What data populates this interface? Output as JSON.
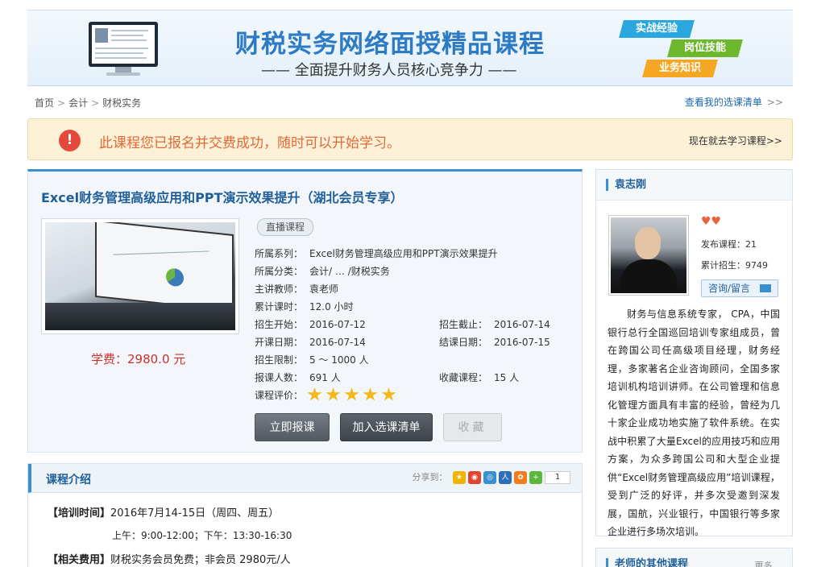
{
  "banner": {
    "title": "财税实务网络面授精品课程",
    "subtitle": "—— 全面提升财务人员核心竞争力 ——",
    "tags": [
      "实战经验",
      "岗位技能",
      "业务知识"
    ]
  },
  "breadcrumb": [
    "首页",
    "会计",
    "财税实务"
  ],
  "my_list_link": "查看我的选课清单",
  "alert": {
    "icon_text": "!",
    "message": "此课程您已报名并交费成功，随时可以开始学习。",
    "link": "现在就去学习课程>>"
  },
  "course": {
    "title": "Excel财务管理高级应用和PPT演示效果提升（湖北会员专享）",
    "type_tag": "直播课程",
    "fee": "学费：2980.0 元",
    "series_label": "所属系列：",
    "series": "Excel财务管理高级应用和PPT演示效果提升",
    "category_label": "所属分类：",
    "category": "会计/ … /财税实务",
    "teacher_label": "主讲教师：",
    "teacher": "袁老师",
    "hours_label": "累计课时：",
    "hours": "12.0 小时",
    "enroll_start_label": "招生开始：",
    "enroll_start": "2016-07-12",
    "enroll_end_label": "招生截止：",
    "enroll_end": "2016-07-14",
    "class_start_label": "开课日期：",
    "class_start": "2016-07-14",
    "class_end_label": "结课日期：",
    "class_end": "2016-07-15",
    "limit_label": "招生限制：",
    "limit": "5 ～ 1000 人",
    "enrolled_label": "报课人数：",
    "enrolled": "691 人",
    "favorites_label": "收藏课程：",
    "favorites": "15 人",
    "rating_label": "课程评价：",
    "rating": 5,
    "buttons": {
      "enroll": "立即报课",
      "add_to_list": "加入选课清单",
      "favorite": "收藏"
    }
  },
  "intro": {
    "title": "课程介绍",
    "share_label": "分享到：",
    "share_count": "1",
    "time_label": "【培训时间】",
    "time_value": "2016年7月14-15日（周四、周五）",
    "schedule": "上午：9:00-12:00；下午：13:30-16:30",
    "fee_label": "【相关费用】",
    "fee_value": "财税实务会员免费；非会员 2980元/人"
  },
  "teacher_panel": {
    "name": "袁志刚",
    "hearts": "♥♥",
    "courses_label": "发布课程：",
    "courses": "21",
    "students_label": "累计招生：",
    "students": "9749",
    "contact": "咨询/留言",
    "bio": "财务与信息系统专家， CPA，中国银行总行全国巡回培训专家组成员，曾在跨国公司任高级项目经理，财务经理，多家著名企业咨询顾问，全国多家培训机构培训讲师。在公司管理和信息化管理方面具有丰富的经验，曾经为几十家企业成功地实施了软件系统。在实战中积累了大量Excel的应用技巧和应用方案，为众多跨国公司和大型企业提供“Excel财务管理高级应用”培训课程，受到广泛的好评，并多次受邀到深发展，国航，兴业银行，中国银行等多家企业进行多场次培训。"
  },
  "other_courses": {
    "title": "老师的其他课程",
    "more": "更多..."
  }
}
